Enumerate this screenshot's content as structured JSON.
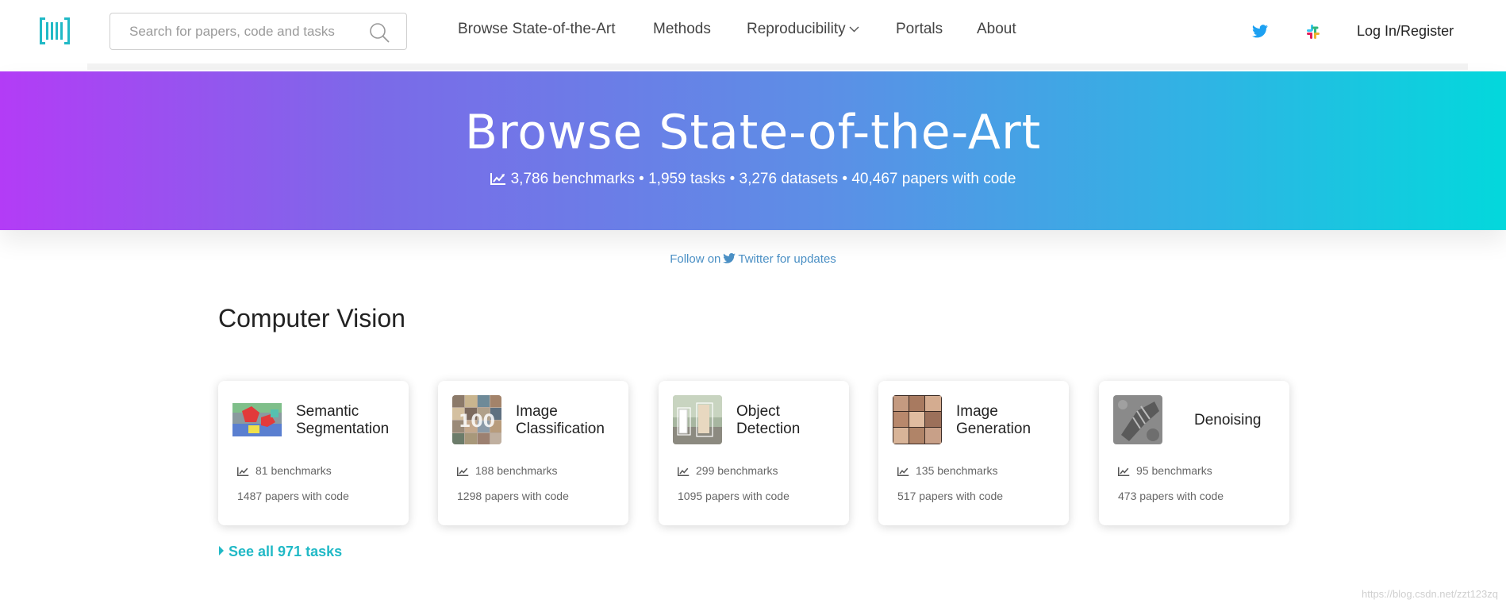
{
  "navbar": {
    "search_placeholder": "Search for papers, code and tasks",
    "links": [
      "Browse State-of-the-Art",
      "Methods",
      "Reproducibility",
      "Portals",
      "About"
    ],
    "login": "Log In/Register"
  },
  "hero": {
    "title": "Browse State-of-the-Art",
    "stats": "3,786 benchmarks • 1,959 tasks • 3,276 datasets • 40,467 papers with code"
  },
  "follow": {
    "prefix": "Follow on",
    "suffix": "Twitter for updates"
  },
  "section": {
    "title": "Computer Vision",
    "cards": [
      {
        "name": "Semantic Segmentation",
        "benchmarks": "81 benchmarks",
        "papers": "1487 papers with code"
      },
      {
        "name": "Image Classification",
        "benchmarks": "188 benchmarks",
        "papers": "1298 papers with code"
      },
      {
        "name": "Object Detection",
        "benchmarks": "299 benchmarks",
        "papers": "1095 papers with code"
      },
      {
        "name": "Image Generation",
        "benchmarks": "135 benchmarks",
        "papers": "517 papers with code"
      },
      {
        "name": "Denoising",
        "benchmarks": "95 benchmarks",
        "papers": "473 papers with code"
      }
    ],
    "see_all": "See all 971 tasks"
  },
  "watermark": "https://blog.csdn.net/zzt123zq",
  "colors": {
    "accent": "#21b9c6",
    "gradient_start": "#b33cf6",
    "gradient_end": "#03d8dc",
    "link_blue": "#4a8fc4"
  },
  "icons": [
    "logo-icon",
    "search-icon",
    "chevron-down-icon",
    "twitter-icon",
    "slack-icon",
    "chart-icon"
  ]
}
